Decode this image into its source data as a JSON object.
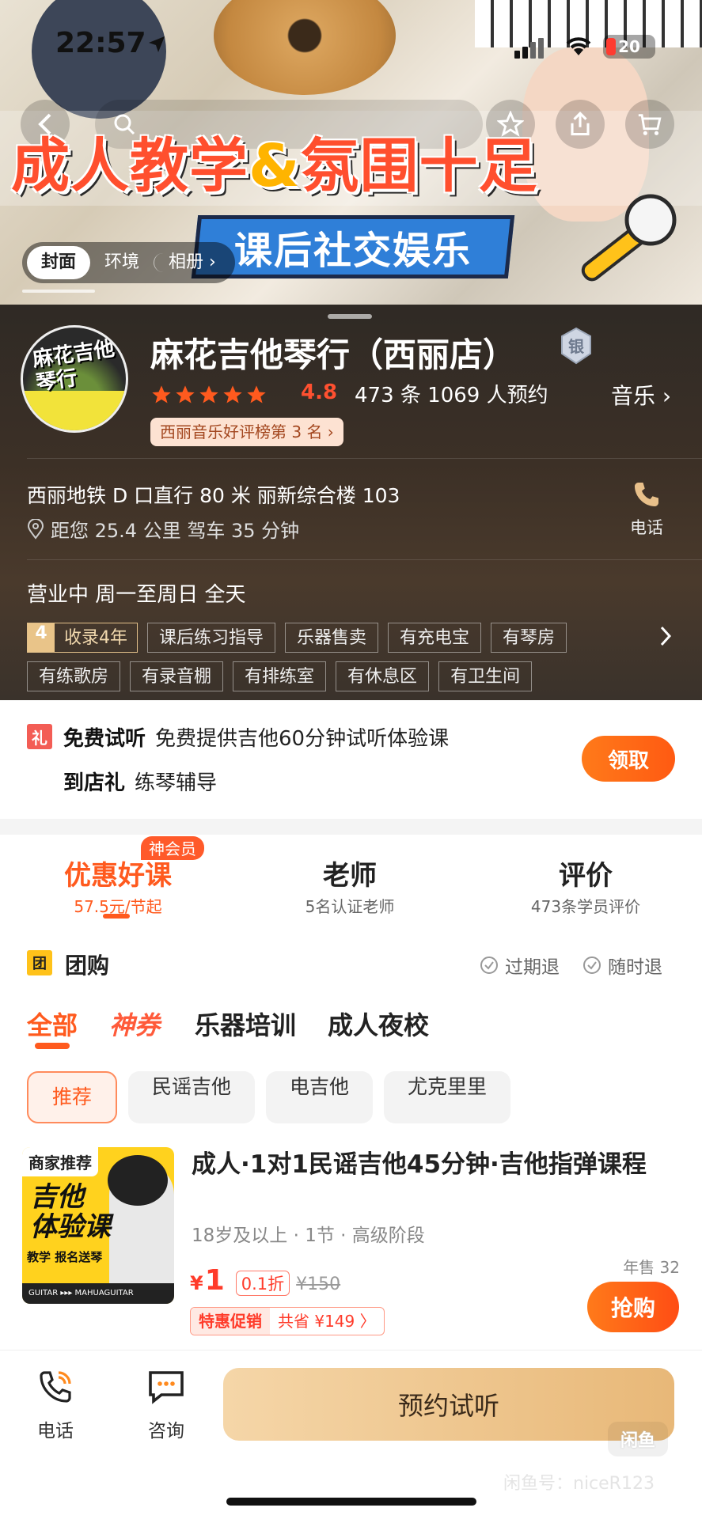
{
  "status_bar": {
    "time": "22:57",
    "battery": "20"
  },
  "hero": {
    "headline_part1": "成人教学",
    "headline_amp": "&",
    "headline_part2": "氛围十足",
    "subtitle": "课后社交娱乐",
    "album_tabs": [
      {
        "label": "封面"
      },
      {
        "label": "环境"
      },
      {
        "label": "相册"
      }
    ]
  },
  "shop": {
    "logo_text": "麻花吉他琴行",
    "name": "麻花吉他琴行（西丽店）",
    "tier_badge": "银",
    "rating": "4.8",
    "stars": 5,
    "reviews_bookings": "473 条 1069 人预约",
    "category": "音乐",
    "rank_badge": "西丽音乐好评榜第 3 名",
    "address": "西丽地铁 D 口直行 80 米 丽新综合楼 103",
    "distance": "距您 25.4 公里 驾车 35 分钟",
    "phone_label": "电话",
    "hours": "营业中 周一至周日 全天",
    "year_badge_num": "4",
    "year_badge_text": "收录4年",
    "tags_row1": [
      "课后练习指导",
      "乐器售卖",
      "有充电宝",
      "有琴房"
    ],
    "tags_row2": [
      "有练歌房",
      "有录音棚",
      "有排练室",
      "有休息区",
      "有卫生间"
    ]
  },
  "gift": {
    "icon": "礼",
    "line1_title": "免费试听",
    "line1_text": "免费提供吉他60分钟试听体验课",
    "line2_title": "到店礼",
    "line2_text": "练琴辅导",
    "claim_label": "领取"
  },
  "main_tabs": [
    {
      "title": "优惠好课",
      "sub": "57.5元/节起",
      "badge": "神会员"
    },
    {
      "title": "老师",
      "sub": "5名认证老师"
    },
    {
      "title": "评价",
      "sub": "473条学员评价"
    }
  ],
  "group_buy": {
    "icon": "团",
    "title": "团购",
    "refund1": "过期退",
    "refund2": "随时退"
  },
  "category_tabs": [
    "全部",
    "神券",
    "乐器培训",
    "成人夜校"
  ],
  "sub_tabs": [
    "推荐",
    "民谣吉他",
    "电吉他",
    "尤克里里"
  ],
  "deal": {
    "img_tag": "商家推荐",
    "img_big1": "吉他",
    "img_big2": "体验课",
    "img_small": "教学 报名送琴",
    "img_bottom": "GUITAR ▸▸▸ MAHUAGUITAR",
    "title": "成人·1对1民谣吉他45分钟·吉他指弹课程",
    "meta": "18岁及以上 · 1节 · 高级阶段",
    "sold": "年售 32",
    "price_currency": "¥",
    "price": "1",
    "discount": "0.1折",
    "original_price": "¥150",
    "promo_label": "特惠促销",
    "promo_saving": "共省 ¥149 〉",
    "buy_label": "抢购"
  },
  "bottom_bar": {
    "phone_label": "电话",
    "consult_label": "咨询",
    "reserve_label": "预约试听",
    "xianyu_logo": "闲鱼",
    "watermark": "闲鱼号：niceR123"
  }
}
